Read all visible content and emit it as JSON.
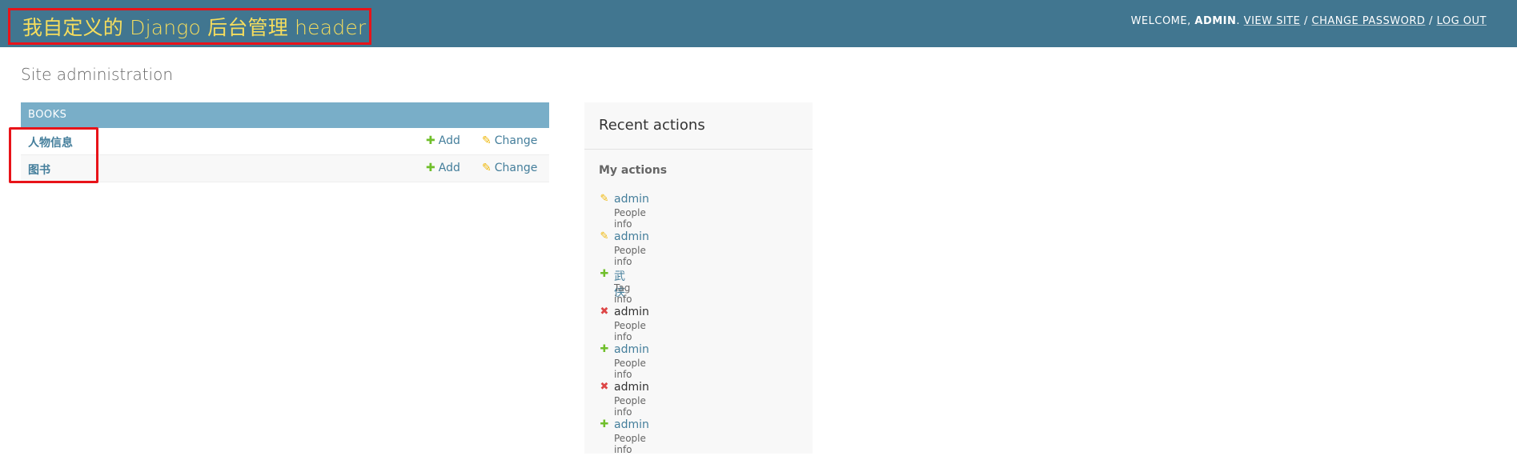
{
  "header": {
    "branding_title": "我自定义的 Django 后台管理 header",
    "user_tools": {
      "welcome": "WELCOME, ",
      "username": "ADMIN",
      "after_username": ". ",
      "view_site": "VIEW SITE",
      "sep1": " / ",
      "change_password": "CHANGE PASSWORD",
      "sep2": " / ",
      "log_out": "LOG OUT"
    }
  },
  "page": {
    "title": "Site administration"
  },
  "app_module": {
    "caption": "BOOKS",
    "models": [
      {
        "name": "人物信息",
        "add_label": "Add",
        "change_label": "Change"
      },
      {
        "name": "图书",
        "add_label": "Add",
        "change_label": "Change"
      }
    ]
  },
  "recent_actions": {
    "title": "Recent actions",
    "subtitle": "My actions",
    "items": [
      {
        "icon": "pencil-icon",
        "name": "admin",
        "type": "People info"
      },
      {
        "icon": "pencil-icon",
        "name": "admin",
        "type": "People info"
      },
      {
        "icon": "plus-icon",
        "name": "武侠",
        "type": "Tag info"
      },
      {
        "icon": "delete-x-icon",
        "name": "admin",
        "type": "People info"
      },
      {
        "icon": "plus-icon",
        "name": "admin",
        "type": "People info"
      },
      {
        "icon": "delete-x-icon",
        "name": "admin",
        "type": "People info"
      },
      {
        "icon": "plus-icon",
        "name": "admin",
        "type": "People info"
      }
    ]
  },
  "colors": {
    "header_bg": "#417690",
    "brand_text": "#f5dd5d",
    "module_caption_bg": "#79aec8",
    "link": "#447e9b",
    "add_icon": "#70bf2b",
    "change_icon": "#efb80b",
    "delete_icon": "#dd4646",
    "highlight_border": "#e81319"
  }
}
